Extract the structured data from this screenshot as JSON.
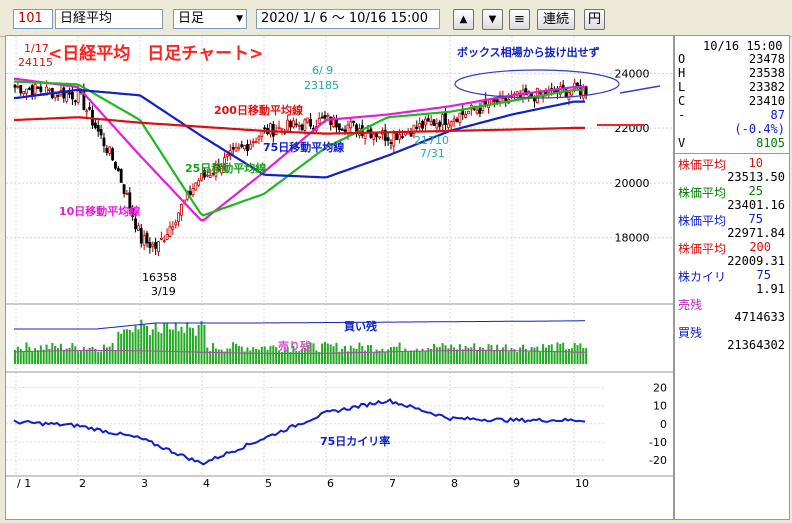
{
  "toolbar": {
    "code": "101",
    "name": "日経平均",
    "period": "日足",
    "date_range": "2020/ 1/ 6 ～ 10/16 15:00",
    "up_btn": "▲",
    "down_btn": "▼",
    "menu_btn": "≡",
    "continuous_btn": "連続",
    "yen_btn": "円"
  },
  "colors": {
    "up": "#cc0000",
    "down": "#000000",
    "ma10": "#e020d8",
    "ma25": "#20b820",
    "ma75": "#1020c8",
    "ma200": "#d81010",
    "volume": "#22aa22",
    "kairi": "#1020c8",
    "annot_red": "#ff2020"
  },
  "annotations": {
    "main_title": "<日経平均　日足チャート>",
    "box_note": "ボックス相場から抜け出せず",
    "ma200_label": "200日移動平均線",
    "ma75_label": "75日移動平均線",
    "ma25_label": "25日移動平均線",
    "ma10_label": "10日移動平均線",
    "buy_remaining": "買い残",
    "sell_remaining": "売り残",
    "kairi_label": "75日カイリ率",
    "hi_jan_date": "1/17",
    "hi_jan_val": "24115",
    "hi_jun_date": "6/ 9",
    "hi_jun_val": "23185",
    "lo_mar_val": "16358",
    "lo_mar_date": "3/19",
    "lo_jul_val": "21710",
    "lo_jul_date": "7/31"
  },
  "right_panel": {
    "datetime": "10/16 15:00",
    "o_label": "O",
    "o_val": "23478",
    "h_label": "H",
    "h_val": "23538",
    "l_label": "L",
    "l_val": "23382",
    "c_label": "C",
    "c_val": "23410",
    "chg_label": "-",
    "chg_val": "87",
    "pct_val": "(-0.4%)",
    "v_label": "V",
    "v_val": "8105",
    "ma10_title": "株価平均",
    "ma10_period": "10",
    "ma10_val": "23513.50",
    "ma25_title": "株価平均",
    "ma25_period": "25",
    "ma25_val": "23401.16",
    "ma75_title": "株価平均",
    "ma75_period": "75",
    "ma75_val": "22971.84",
    "ma200_title": "株価平均",
    "ma200_period": "200",
    "ma200_val": "22009.31",
    "kairi_title": "株カイリ",
    "kairi_period": "75",
    "kairi_val": "1.91",
    "sell_title": "売残",
    "sell_val": "4714633",
    "buy_title": "買残",
    "buy_val": "21364302"
  },
  "chart_data": [
    {
      "type": "candlestick",
      "title": "<日経平均　日足チャート>",
      "y_ticks": [
        "24000",
        "22000",
        "20000",
        "18000"
      ],
      "ylim": [
        15800,
        25000
      ],
      "x_ticks": [
        "1",
        "2",
        "3",
        "4",
        "5",
        "6",
        "7",
        "8",
        "9",
        "10"
      ],
      "key_points": [
        {
          "date": "1/17",
          "value": 24115
        },
        {
          "date": "3/19",
          "value": 16358
        },
        {
          "date": "6/9",
          "value": 23185
        },
        {
          "date": "7/31",
          "value": 21710
        },
        {
          "date": "10/16",
          "open": 23478,
          "high": 23538,
          "low": 23382,
          "close": 23410
        }
      ],
      "monthly_close_approx": [
        23500,
        23200,
        18900,
        20200,
        21900,
        22300,
        21700,
        22400,
        23100,
        23400
      ],
      "series": [
        {
          "name": "10日移動平均線",
          "last": 23513.5,
          "monthly_approx": [
            23800,
            23500,
            21000,
            18600,
            20400,
            22300,
            22500,
            22800,
            23200,
            23500
          ]
        },
        {
          "name": "25日移動平均線",
          "last": 23401.16,
          "monthly_approx": [
            23700,
            23600,
            22300,
            18800,
            19600,
            21300,
            22400,
            22600,
            23000,
            23400
          ]
        },
        {
          "name": "75日移動平均線",
          "last": 22971.84,
          "monthly_approx": [
            23100,
            23400,
            23200,
            21700,
            20300,
            20200,
            21000,
            21900,
            22500,
            22970
          ]
        },
        {
          "name": "200日移動平均線",
          "last": 22009.31,
          "monthly_approx": [
            22300,
            22400,
            22200,
            22050,
            21900,
            21800,
            21850,
            21900,
            21950,
            22009
          ]
        }
      ]
    },
    {
      "type": "bar",
      "title": "",
      "series": [
        {
          "name": "買い残",
          "last": 21364302
        },
        {
          "name": "売り残",
          "last": 4714633
        }
      ]
    },
    {
      "type": "line",
      "title": "",
      "series_name": "75日カイリ率",
      "y_ticks": [
        "20",
        "10",
        "0",
        "-10",
        "-20"
      ],
      "ylim": [
        -25,
        22
      ],
      "last": 1.91,
      "monthly_approx": [
        1,
        -1,
        -8,
        -22,
        -8,
        6,
        13,
        3,
        2,
        2
      ]
    }
  ]
}
